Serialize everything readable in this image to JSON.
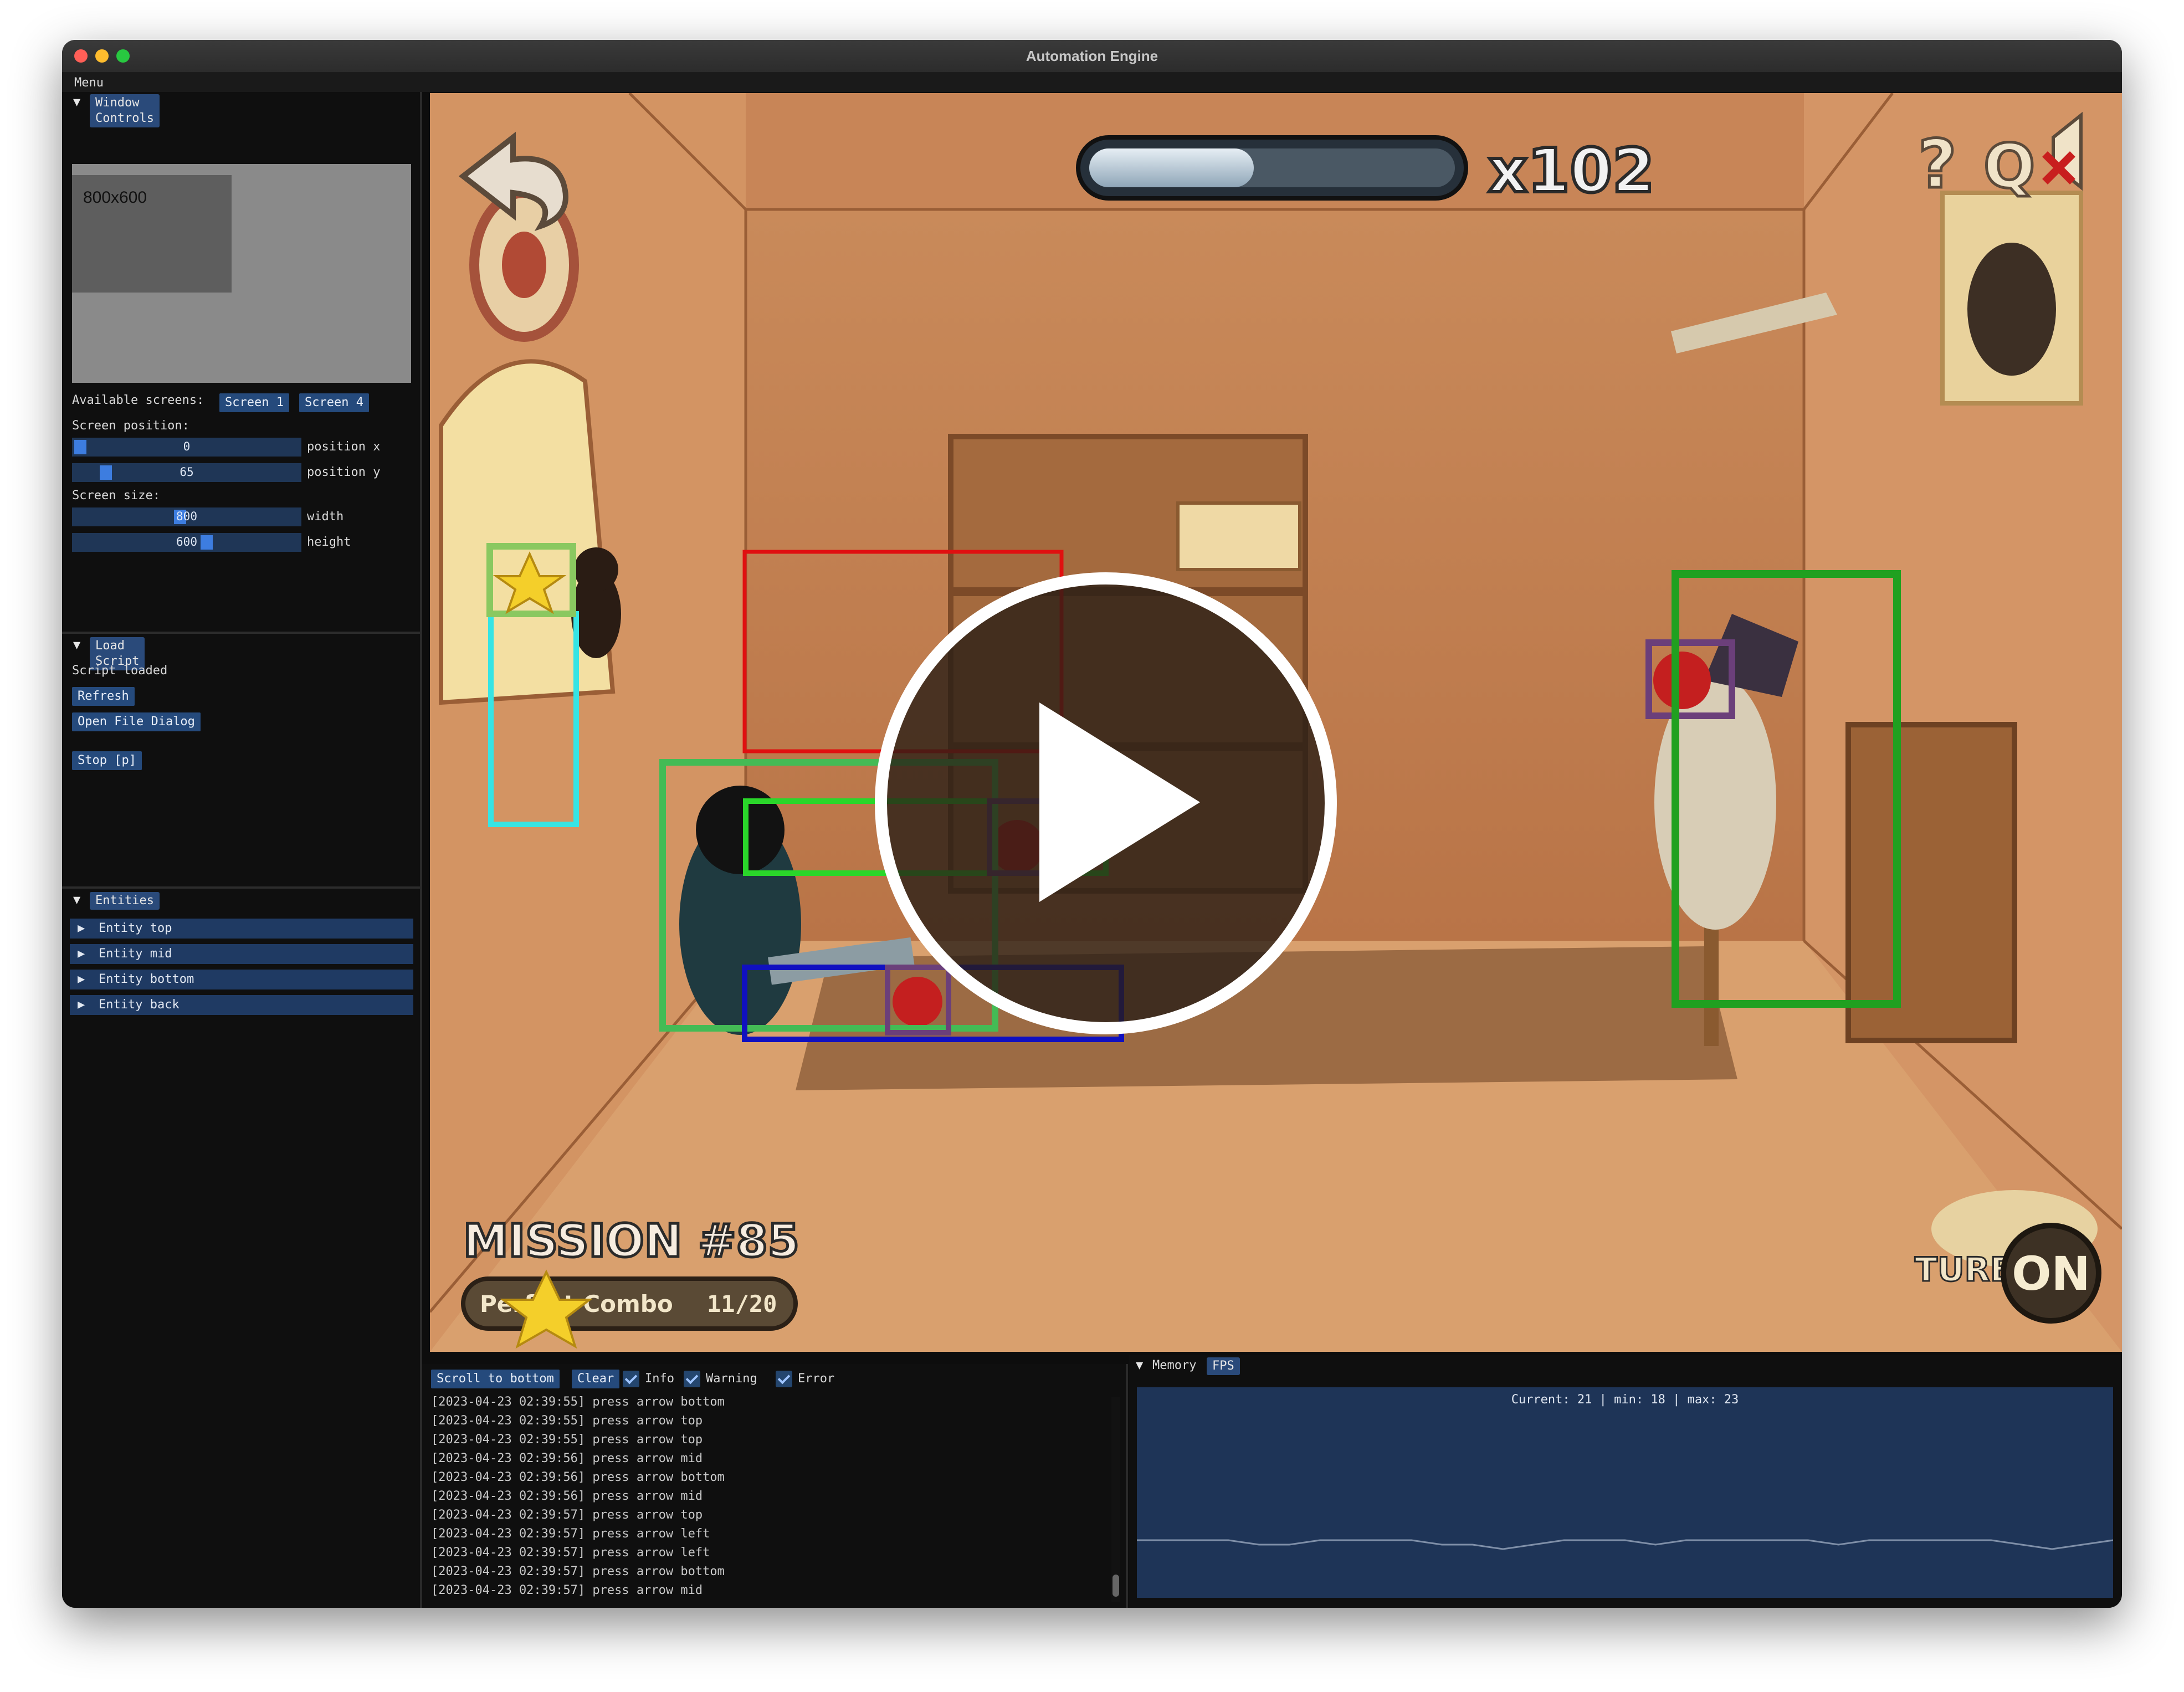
{
  "window": {
    "title": "Automation Engine",
    "menu": "Menu"
  },
  "window_controls": {
    "header": "Window Controls",
    "preview_label": "800x600",
    "available_screens_label": "Available screens:",
    "screens": [
      "Screen 1",
      "Screen 4"
    ],
    "screen_position_label": "Screen position:",
    "position_x": {
      "value": "0",
      "label": "position x"
    },
    "position_y": {
      "value": "65",
      "label": "position y"
    },
    "screen_size_label": "Screen size:",
    "width": {
      "value": "800",
      "label": "width"
    },
    "height": {
      "value": "600",
      "label": "height"
    }
  },
  "load_script": {
    "header": "Load Script",
    "status": "Script loaded",
    "refresh": "Refresh",
    "open_file": "Open File Dialog",
    "stop": "Stop [p]"
  },
  "entities": {
    "header": "Entities",
    "items": [
      "Entity top",
      "Entity mid",
      "Entity bottom",
      "Entity back"
    ]
  },
  "game": {
    "multiplier": "x102",
    "progress": 0.45,
    "mission": "MISSION #85",
    "combo_label": "Perfect Combo",
    "combo_count": "11/20",
    "turbo_label": "TURBO",
    "turbo_state": "ON",
    "help_icon": "?",
    "quality_icon": "Q",
    "icons": [
      "back-arrow-icon",
      "help-icon",
      "quality-icon",
      "sound-muted-icon",
      "play-icon"
    ],
    "box_colors": [
      "#e01010",
      "#2ad62a",
      "#44bb55",
      "#1010c0",
      "#36e4e4",
      "#8ac860",
      "#6b3f7a",
      "#20a020"
    ]
  },
  "console": {
    "scroll_to_bottom": "Scroll to bottom",
    "clear": "Clear",
    "filters": [
      "Info",
      "Warning",
      "Error"
    ],
    "lines": [
      "[2023-04-23 02:39:55] press arrow bottom",
      "[2023-04-23 02:39:55] press arrow top",
      "[2023-04-23 02:39:55] press arrow top",
      "[2023-04-23 02:39:56] press arrow mid",
      "[2023-04-23 02:39:56] press arrow bottom",
      "[2023-04-23 02:39:56] press arrow mid",
      "[2023-04-23 02:39:57] press arrow top",
      "[2023-04-23 02:39:57] press arrow left",
      "[2023-04-23 02:39:57] press arrow left",
      "[2023-04-23 02:39:57] press arrow bottom",
      "[2023-04-23 02:39:57] press arrow mid"
    ]
  },
  "perf": {
    "tabs": [
      "Memory",
      "FPS"
    ],
    "caption": "Current: 21 | min: 18 | max: 23",
    "fps_series": [
      21,
      21,
      21,
      21,
      20,
      20,
      21,
      21,
      21,
      21,
      20,
      20,
      19,
      20,
      21,
      21,
      21,
      20,
      21,
      21,
      21,
      21,
      21,
      20,
      21,
      21,
      21,
      21,
      21,
      20,
      19,
      20,
      21
    ]
  }
}
